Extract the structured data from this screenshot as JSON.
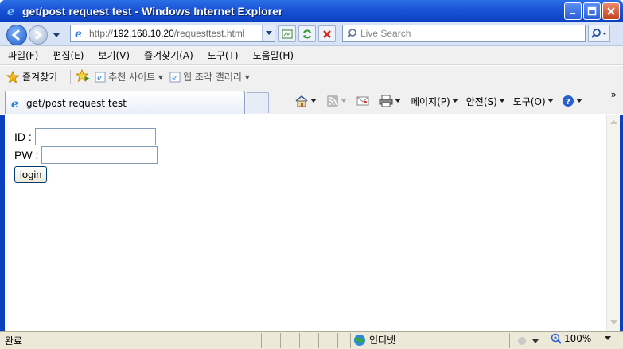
{
  "window": {
    "title": "get/post request test - Windows Internet Explorer"
  },
  "address": {
    "url_prefix": "http://",
    "url_host": "192.168.10.20",
    "url_path": "/requesttest.html"
  },
  "search": {
    "placeholder": "Live Search"
  },
  "menu": {
    "items": [
      "파일(F)",
      "편집(E)",
      "보기(V)",
      "즐겨찾기(A)",
      "도구(T)",
      "도움말(H)"
    ]
  },
  "favorites": {
    "label": "즐겨찾기",
    "links": [
      "추천 사이트 ▾",
      "웹 조각 갤러리 ▾"
    ]
  },
  "tab": {
    "title": "get/post request test"
  },
  "commands": {
    "page": "페이지(P)",
    "safety": "안전(S)",
    "tools": "도구(O)"
  },
  "form": {
    "id_label": "ID :",
    "pw_label": "PW :",
    "id_value": "",
    "pw_value": "",
    "login_label": "login"
  },
  "status": {
    "text": "완료",
    "zone": "인터넷",
    "zoom": "100%"
  },
  "colors": {
    "titlebar": "#1c55d8",
    "accent": "#0a3fc0"
  }
}
